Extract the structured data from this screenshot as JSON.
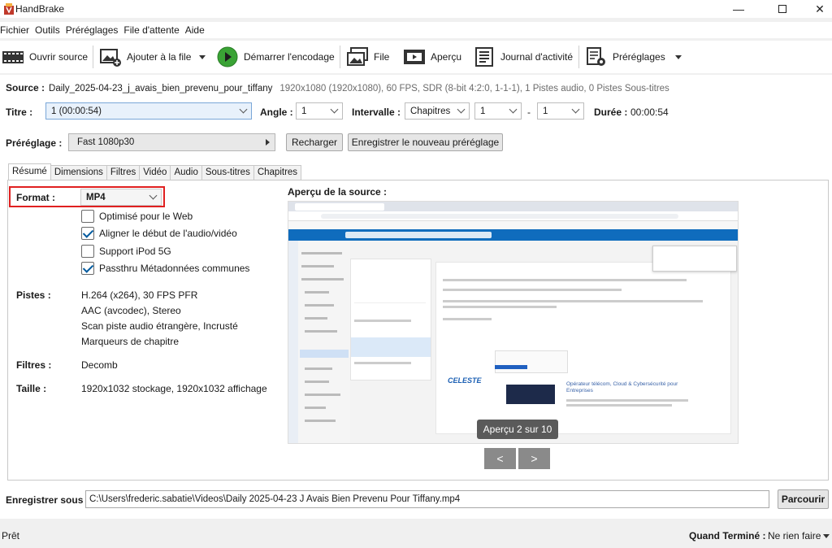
{
  "window": {
    "title": "HandBrake"
  },
  "menu": [
    "Fichier",
    "Outils",
    "Préréglages",
    "File d'attente",
    "Aide"
  ],
  "toolbar": {
    "open_source": "Ouvrir source",
    "add_to_queue": "Ajouter à la file",
    "start_encode": "Démarrer l'encodage",
    "queue": "File",
    "preview": "Aperçu",
    "activity_log": "Journal d'activité",
    "presets": "Préréglages"
  },
  "source": {
    "label": "Source :",
    "name": "Daily_2025-04-23_j_avais_bien_prevenu_pour_tiffany",
    "info": "1920x1080 (1920x1080), 60 FPS, SDR (8-bit 4:2:0, 1-1-1), 1 Pistes audio, 0 Pistes Sous-titres"
  },
  "title_row": {
    "title_label": "Titre :",
    "title_value": "1 (00:00:54)",
    "angle_label": "Angle :",
    "angle_value": "1",
    "range_label": "Intervalle :",
    "range_type": "Chapitres",
    "range_start": "1",
    "range_dash": "-",
    "range_end": "1",
    "duration_label": "Durée :",
    "duration_value": "00:00:54"
  },
  "preset_row": {
    "label": "Préréglage :",
    "value": "Fast 1080p30",
    "reload": "Recharger",
    "save_new": "Enregistrer le nouveau préréglage"
  },
  "tabs": [
    "Résumé",
    "Dimensions",
    "Filtres",
    "Vidéo",
    "Audio",
    "Sous-titres",
    "Chapitres"
  ],
  "summary": {
    "format_label": "Format :",
    "format_value": "MP4",
    "options": [
      {
        "label": "Optimisé pour le Web",
        "checked": false
      },
      {
        "label": "Aligner le début de l'audio/vidéo",
        "checked": true
      },
      {
        "label": "Support iPod 5G",
        "checked": false
      },
      {
        "label": "Passthru Métadonnées communes",
        "checked": true
      }
    ],
    "tracks_label": "Pistes :",
    "tracks": [
      "H.264 (x264), 30 FPS PFR",
      "AAC (avcodec), Stereo",
      "Scan piste audio étrangère, Incrusté",
      "Marqueurs de chapitre"
    ],
    "filters_label": "Filtres :",
    "filters_value": "Decomb",
    "size_label": "Taille :",
    "size_value": "1920x1032 stockage, 1920x1032 affichage"
  },
  "preview": {
    "heading": "Aperçu de la source :",
    "badge": "Aperçu 2 sur 10",
    "prev": "<",
    "next": ">",
    "thumb_brand": "CELESTE",
    "thumb_heading": "Opérateur télécom, Cloud & Cybersécurité pour Entreprises"
  },
  "save_row": {
    "label": "Enregistrer sous :",
    "path": "C:\\Users\\frederic.sabatie\\Videos\\Daily 2025-04-23 J Avais Bien Prevenu Pour Tiffany.mp4",
    "browse": "Parcourir"
  },
  "status": {
    "state": "Prêt",
    "when_done_label": "Quand Terminé :",
    "when_done_value": "Ne rien faire"
  },
  "colors": {
    "accent_red": "#e02020",
    "play_green": "#3aa335",
    "selection_blue": "#e8f1fb"
  }
}
